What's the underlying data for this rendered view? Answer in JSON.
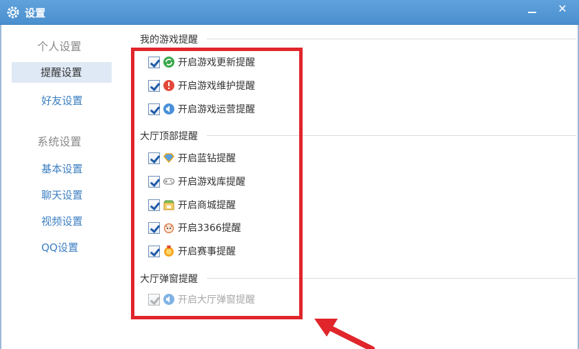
{
  "window": {
    "title": "设置"
  },
  "sidebar": {
    "personal_group": "个人设置",
    "reminder": "提醒设置",
    "friends": "好友设置",
    "system_group": "系统设置",
    "basic": "基本设置",
    "chat": "聊天设置",
    "video": "视频设置",
    "qq": "QQ设置"
  },
  "sections": {
    "my_games": {
      "title": "我的游戏提醒",
      "options": [
        "开启游戏更新提醒",
        "开启游戏维护提醒",
        "开启游戏运营提醒"
      ]
    },
    "hall_top": {
      "title": "大厅顶部提醒",
      "options": [
        "开启蓝钻提醒",
        "开启游戏库提醒",
        "开启商城提醒",
        "开启3366提醒",
        "开启赛事提醒"
      ]
    },
    "hall_popup": {
      "title": "大厅弹窗提醒",
      "options": [
        "开启大厅弹窗提醒"
      ]
    }
  },
  "icons": {
    "game_update": "green-refresh-icon",
    "game_maintenance": "red-alert-icon",
    "game_operation": "blue-speaker-icon",
    "blue_diamond": "blue-diamond-icon",
    "game_library": "gamepad-icon",
    "mall": "shop-icon",
    "3366": "3366-mascot-icon",
    "tournament": "medal-icon",
    "hall_popup": "speaker-icon"
  },
  "colors": {
    "titlebar": "#4a8fcf",
    "highlight": "#e0252b",
    "link": "#3c7fc2"
  }
}
